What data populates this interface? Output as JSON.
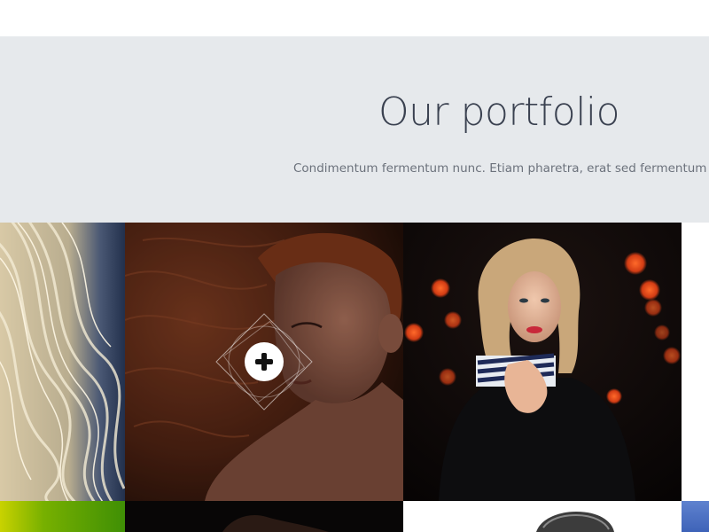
{
  "portfolio": {
    "title": "Our portfolio",
    "subtitle": "Condimentum fermentum nunc. Etiam pharetra, erat sed fermentum feugiat"
  },
  "gallery": {
    "items": [
      {
        "name": "blonde-hair-photo"
      },
      {
        "name": "red-hair-woman-photo",
        "hovered": true,
        "icon": "plus-icon"
      },
      {
        "name": "blonde-woman-black-coat-photo"
      },
      {
        "name": "blue-tile-photo"
      }
    ]
  },
  "colors": {
    "header_bg": "#e6e9ec",
    "title": "#3a4150",
    "subtitle": "#6c727c"
  }
}
